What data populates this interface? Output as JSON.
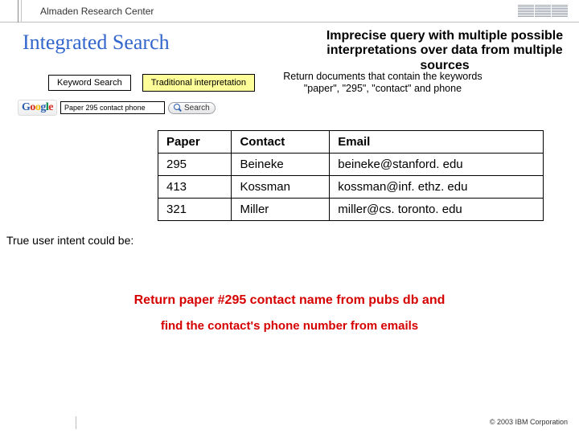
{
  "header": {
    "org": "Almaden Research Center",
    "logo_alt": "IBM"
  },
  "title": "Integrated Search",
  "subtitle": "Imprecise query with multiple possible interpretations over data from multiple sources",
  "labels": {
    "keyword_search": "Keyword Search",
    "traditional_interpretation": "Traditional interpretation"
  },
  "interpretation_text": "Return documents that contain the keywords \"paper\", \"295\", \"contact\" and phone",
  "search": {
    "value": "Paper 295 contact phone",
    "button": "Search"
  },
  "table": {
    "headers": [
      "Paper",
      "Contact",
      "Email"
    ],
    "rows": [
      [
        "295",
        "Beineke",
        "beineke@stanford. edu"
      ],
      [
        "413",
        "Kossman",
        "kossman@inf. ethz. edu"
      ],
      [
        "321",
        "Miller",
        "miller@cs. toronto. edu"
      ]
    ]
  },
  "intent": {
    "label": "True user intent could be:",
    "line1": "Return paper #295 contact name from pubs db and",
    "line2": "find the contact's phone number from emails"
  },
  "footer": "© 2003 IBM Corporation"
}
